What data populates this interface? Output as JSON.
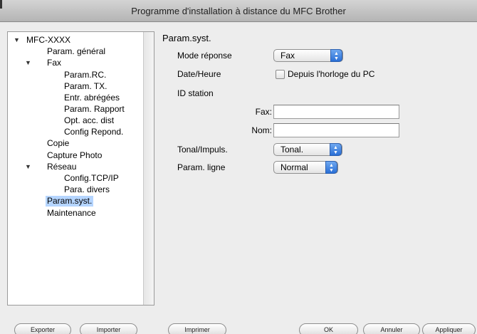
{
  "window": {
    "title": "Programme d'installation à distance du MFC Brother"
  },
  "tree": {
    "items": [
      {
        "label": "MFC-XXXX"
      },
      {
        "label": "Param. général"
      },
      {
        "label": "Fax"
      },
      {
        "label": "Param.RC."
      },
      {
        "label": "Param. TX."
      },
      {
        "label": "Entr. abrégées"
      },
      {
        "label": "Param. Rapport"
      },
      {
        "label": "Opt. acc. dist"
      },
      {
        "label": "Config Repond."
      },
      {
        "label": "Copie"
      },
      {
        "label": "Capture Photo"
      },
      {
        "label": "Réseau"
      },
      {
        "label": "Config.TCP/IP"
      },
      {
        "label": "Para. divers"
      },
      {
        "label": "Param.syst."
      },
      {
        "label": "Maintenance"
      }
    ],
    "selected": "Param.syst."
  },
  "panel": {
    "title": "Param.syst.",
    "mode_reponse_label": "Mode réponse",
    "mode_reponse_value": "Fax",
    "date_heure_label": "Date/Heure",
    "depuis_horloge_label": "Depuis l'horloge du PC",
    "depuis_horloge_checked": false,
    "id_station_label": "ID station",
    "fax_label": "Fax:",
    "fax_value": "",
    "nom_label": "Nom:",
    "nom_value": "",
    "tonal_label": "Tonal/Impuls.",
    "tonal_value": "Tonal.",
    "param_ligne_label": "Param. ligne",
    "param_ligne_value": "Normal"
  },
  "buttons": {
    "exporter": "Exporter",
    "importer": "Importer",
    "imprimer": "Imprimer",
    "ok": "OK",
    "annuler": "Annuler",
    "appliquer": "Appliquer"
  },
  "colors": {
    "selection": "#b5d5ff",
    "popup_arrow": "#2a6fd6"
  }
}
